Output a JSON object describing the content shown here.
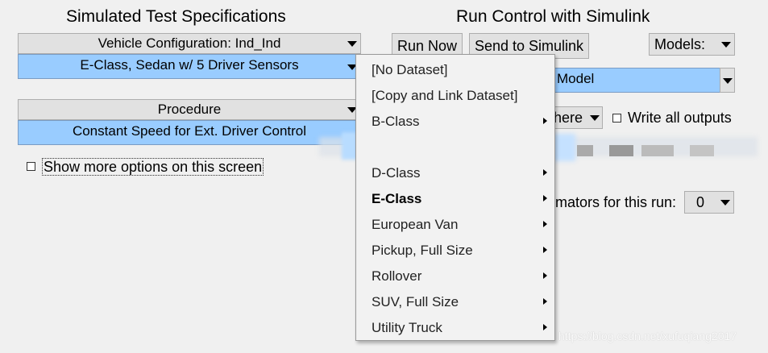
{
  "left_panel": {
    "title": "Simulated Test Specifications",
    "vehicle_config_label": "Vehicle Configuration: Ind_Ind",
    "vehicle_value": "E-Class, Sedan w/ 5 Driver Sensors",
    "procedure_label": "Procedure",
    "procedure_value": "Constant Speed for Ext. Driver Control",
    "show_more_label": "Show more options on this screen",
    "show_more_checked": false
  },
  "right_panel": {
    "title": "Run Control with Simulink",
    "run_now_label": "Run Now",
    "send_label": "Send to Simulink",
    "models_label": "Models:",
    "model_value": "Model",
    "location_value": "here",
    "write_outputs_label": "Write all outputs",
    "write_outputs_checked": false,
    "animators_label": "mators for this run:",
    "animators_value": "0"
  },
  "dropdown_menu": {
    "items": [
      {
        "label": "[No Dataset]",
        "submenu": false,
        "bold": false
      },
      {
        "label": "[Copy and Link Dataset]",
        "submenu": false,
        "bold": false
      },
      {
        "label": "B-Class",
        "submenu": true,
        "bold": false
      },
      {
        "label": "",
        "submenu": false,
        "bold": false
      },
      {
        "label": "D-Class",
        "submenu": true,
        "bold": false
      },
      {
        "label": "E-Class",
        "submenu": true,
        "bold": true
      },
      {
        "label": "European Van",
        "submenu": true,
        "bold": false
      },
      {
        "label": "Pickup, Full Size",
        "submenu": true,
        "bold": false
      },
      {
        "label": "Rollover",
        "submenu": true,
        "bold": false
      },
      {
        "label": "SUV, Full Size",
        "submenu": true,
        "bold": false
      },
      {
        "label": "Utility Truck",
        "submenu": true,
        "bold": false
      }
    ]
  },
  "watermark": "https://blog.csdn.net/xufuqiang2017",
  "colors": {
    "selected_bg": "#99ccff",
    "window_bg": "#f0f0f0",
    "button_bg": "#e1e1e1"
  }
}
